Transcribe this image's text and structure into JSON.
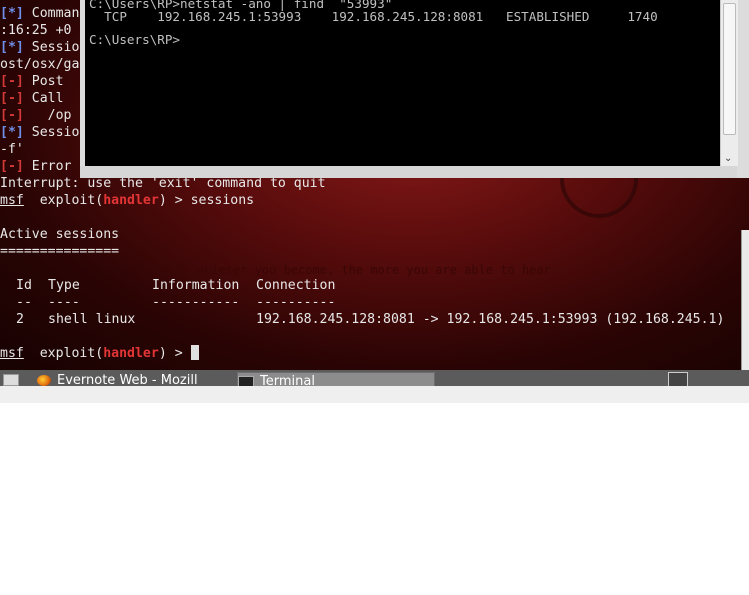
{
  "wallpaper": {
    "quote": "The quieter you become, the more you are able to hear"
  },
  "msf_console": {
    "partial_left_lines": [
      {
        "marker": "[*]",
        "text": " Command"
      },
      {
        "marker": "",
        "text": ":16:25 +0"
      },
      {
        "marker": "[*]",
        "text": " Sessio"
      },
      {
        "marker": "",
        "text": "ost/osx/ga"
      },
      {
        "marker": "[-]",
        "text": " Post "
      },
      {
        "marker": "[-]",
        "text": " Call "
      },
      {
        "marker": "[-]",
        "text": "   /op"
      },
      {
        "marker": "[*]",
        "text": " Sessio"
      },
      {
        "marker": "",
        "text": "-f'"
      },
      {
        "marker": "[-]",
        "text": " Error"
      }
    ],
    "interrupt_line": "Interrupt: use the 'exit' command to quit",
    "prompt_msf": "msf",
    "prompt_exploit": "  exploit(",
    "prompt_handler": "handler",
    "prompt_tail": ") > ",
    "command_sessions": "sessions",
    "active_sessions_title": "Active sessions",
    "underline": "===============",
    "table": {
      "headers": [
        "Id",
        "Type",
        "Information",
        "Connection"
      ],
      "dashes": [
        "--",
        "----",
        "-----------",
        "----------"
      ],
      "rows": [
        {
          "id": "2",
          "type": "shell linux",
          "information": "",
          "connection": "192.168.245.128:8081 -> 192.168.245.1:53993 (192.168.245.1)"
        }
      ]
    },
    "final_prompt_tail": ") > "
  },
  "cmd_window": {
    "lines": [
      "C:\\Users\\RP>netstat -ano | find  \"53993\"",
      "  TCP    192.168.245.1:53993    192.168.245.128:8081   ESTABLISHED     1740",
      "",
      "C:\\Users\\RP>"
    ]
  },
  "taskbar": {
    "items": [
      {
        "label": "Evernote Web - Mozill",
        "icon": "firefox-icon",
        "active": false
      },
      {
        "label": "Terminal",
        "icon": "terminal-icon",
        "active": true
      }
    ]
  }
}
